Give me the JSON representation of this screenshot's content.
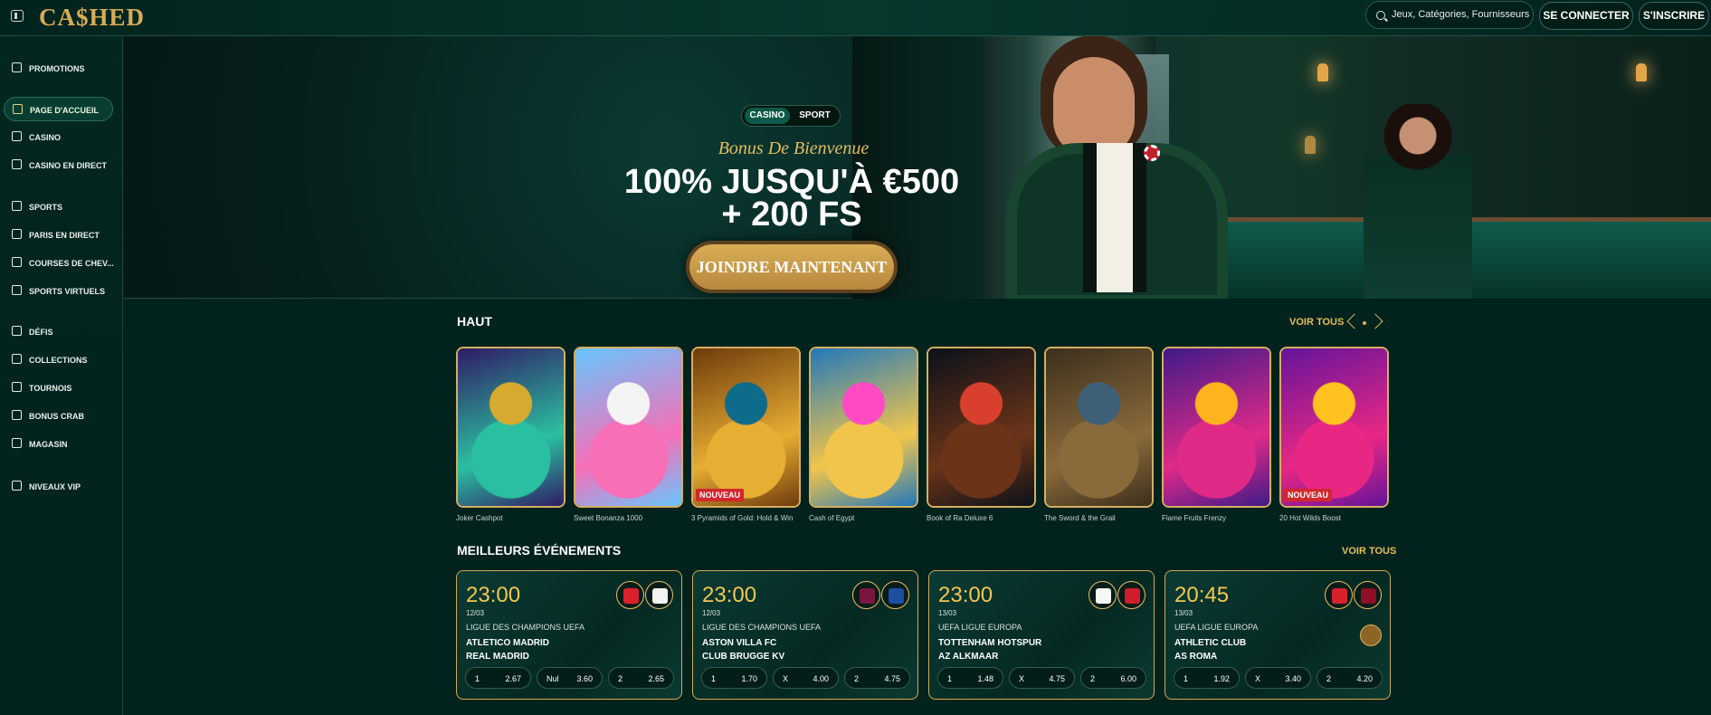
{
  "brand": {
    "logo": "CA$HED"
  },
  "header": {
    "search_placeholder": "Jeux, Catégories, Fournisseurs",
    "login": "SE CONNECTER",
    "register": "S'INSCRIRE"
  },
  "sidebar": {
    "items": [
      {
        "label": "PROMOTIONS",
        "icon": "gift-icon"
      },
      {
        "label": "PAGE D'ACCUEIL",
        "icon": "home-icon",
        "active": true
      },
      {
        "label": "CASINO",
        "icon": "slot-machine-icon"
      },
      {
        "label": "CASINO EN DIRECT",
        "icon": "live-casino-icon"
      },
      {
        "label": "SPORTS",
        "icon": "soccer-ball-icon"
      },
      {
        "label": "PARIS EN DIRECT",
        "icon": "live-bet-icon"
      },
      {
        "label": "COURSES DE CHEV...",
        "icon": "horse-icon"
      },
      {
        "label": "SPORTS VIRTUELS",
        "icon": "virtual-sports-icon"
      },
      {
        "label": "DÉFIS",
        "icon": "badge-icon"
      },
      {
        "label": "COLLECTIONS",
        "icon": "collections-icon"
      },
      {
        "label": "TOURNOIS",
        "icon": "trophy-icon"
      },
      {
        "label": "BONUS CRAB",
        "icon": "crab-icon"
      },
      {
        "label": "MAGASIN",
        "icon": "shop-basket-icon"
      },
      {
        "label": "NIVEAUX VIP",
        "icon": "diamond-icon"
      }
    ]
  },
  "hero": {
    "tabs": [
      "CASINO",
      "SPORT"
    ],
    "subtitle": "Bonus De Bienvenue",
    "title_line1": "100% JUSQU'À €500",
    "title_line2": "+ 200 FS",
    "cta": "JOINDRE MAINTENANT"
  },
  "top_games": {
    "title": "HAUT",
    "see_all": "VOIR TOUS",
    "games": [
      {
        "name": "Joker Cashpot",
        "colors": [
          "#2f1b65",
          "#2bbfa1",
          "#d5aa2e"
        ]
      },
      {
        "name": "Sweet Bonanza 1000",
        "colors": [
          "#67c6ff",
          "#f66fb7",
          "#f4f4f4"
        ]
      },
      {
        "name": "3 Pyramids of Gold: Hold & Win",
        "colors": [
          "#6d3b0b",
          "#e8ad33",
          "#0e6b8a"
        ],
        "badge": "NOUVEAU"
      },
      {
        "name": "Cash of Egypt",
        "colors": [
          "#2278bb",
          "#f1c54b",
          "#ff4ac3"
        ]
      },
      {
        "name": "Book of Ra Deluxe 6",
        "colors": [
          "#0b1119",
          "#6b3419",
          "#d8402d"
        ]
      },
      {
        "name": "The Sword & the Grail",
        "colors": [
          "#3c2f1d",
          "#8a6a3b",
          "#3e5f78"
        ]
      },
      {
        "name": "Flame Fruits Frenzy",
        "colors": [
          "#3f1a88",
          "#df2a88",
          "#ffb31c"
        ]
      },
      {
        "name": "20 Hot Wilds Boost",
        "colors": [
          "#64149a",
          "#e82785",
          "#ffc21f"
        ],
        "badge": "NOUVEAU"
      }
    ]
  },
  "events": {
    "title": "MEILLEURS ÉVÉNEMENTS",
    "see_all": "VOIR TOUS",
    "items": [
      {
        "time": "23:00",
        "date": "12/03",
        "league": "LIGUE DES CHAMPIONS UEFA",
        "home": "ATLETICO MADRID",
        "away": "REAL MADRID",
        "odds": [
          [
            "1",
            "2.67"
          ],
          [
            "Nul",
            "3.60"
          ],
          [
            "2",
            "2.65"
          ]
        ],
        "home_color": "#d9212c",
        "away_color": "#f3f3f3"
      },
      {
        "time": "23:00",
        "date": "12/03",
        "league": "LIGUE DES CHAMPIONS UEFA",
        "home": "ASTON VILLA FC",
        "away": "CLUB BRUGGE KV",
        "odds": [
          [
            "1",
            "1.70"
          ],
          [
            "X",
            "4.00"
          ],
          [
            "2",
            "4.75"
          ]
        ],
        "home_color": "#7a163d",
        "away_color": "#1c4ea2"
      },
      {
        "time": "23:00",
        "date": "13/03",
        "league": "UEFA LIGUE EUROPA",
        "home": "TOTTENHAM HOTSPUR",
        "away": "AZ ALKMAAR",
        "odds": [
          [
            "1",
            "1.48"
          ],
          [
            "X",
            "4.75"
          ],
          [
            "2",
            "6.00"
          ]
        ],
        "home_color": "#f7f7f7",
        "away_color": "#d11c2b"
      },
      {
        "time": "20:45",
        "date": "13/03",
        "league": "UEFA LIGUE EUROPA",
        "home": "ATHLETIC CLUB",
        "away": "AS ROMA",
        "odds": [
          [
            "1",
            "1.92"
          ],
          [
            "X",
            "3.40"
          ],
          [
            "2",
            "4.20"
          ]
        ],
        "home_color": "#d9212c",
        "away_color": "#8e0f27"
      }
    ]
  }
}
